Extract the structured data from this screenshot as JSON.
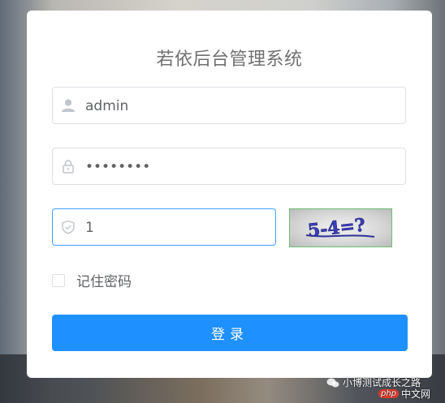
{
  "title": "若依后台管理系统",
  "form": {
    "username": {
      "value": "admin",
      "icon": "user-icon"
    },
    "password": {
      "value": "••••••••",
      "icon": "lock-icon"
    },
    "code": {
      "value": "1",
      "icon": "shield-icon"
    },
    "captcha_text": "5-4=?",
    "remember_label": "记住密码",
    "login_label": "登录"
  },
  "watermark": {
    "text": "小博测试成长之路",
    "site": "中文网",
    "badge": "php"
  },
  "colors": {
    "accent": "#1e90ff",
    "focus_border": "#409eff"
  }
}
